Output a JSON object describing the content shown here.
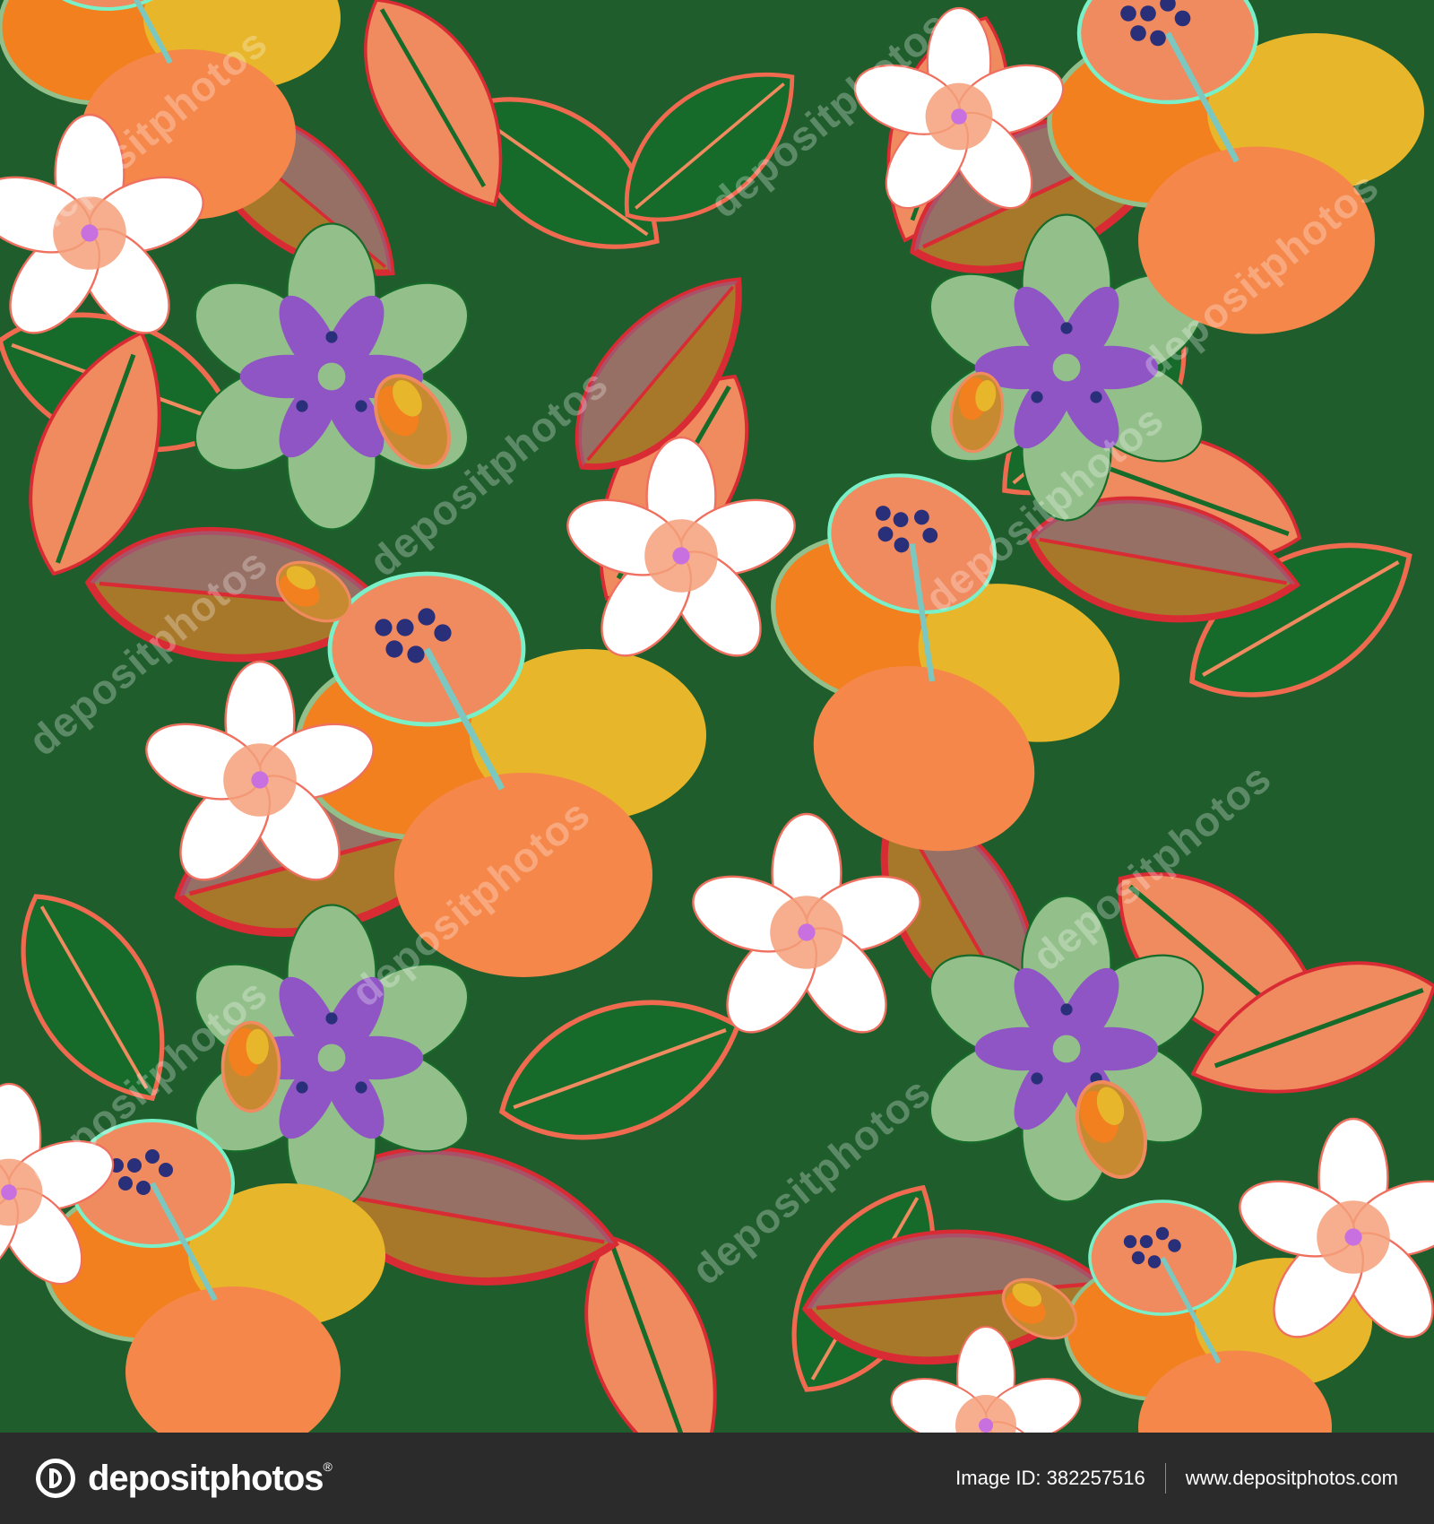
{
  "artwork": {
    "background_color": "#1f5e2c",
    "palette": {
      "leaf_dark": "#176b2a",
      "leaf_coral": "#f08a5f",
      "leaf_red": "#d92b34",
      "leaf_olive": "#a8782a",
      "hibiscus_orange": "#f2801e",
      "hibiscus_yellow": "#e8b62a",
      "hibiscus_sage": "#93c08a",
      "plumeria_white": "#ffffff",
      "plumeria_center": "#f5a07a",
      "aster_purple": "#8f55c4",
      "stamen_navy": "#2a2f7a"
    },
    "watermark_text": "depositphotos"
  },
  "footer": {
    "brand_name": "depositphotos",
    "brand_mark": "depositphotos-logo-icon",
    "image_id_label": "Image ID:",
    "image_id_value": "382257516",
    "website": "www.depositphotos.com"
  }
}
